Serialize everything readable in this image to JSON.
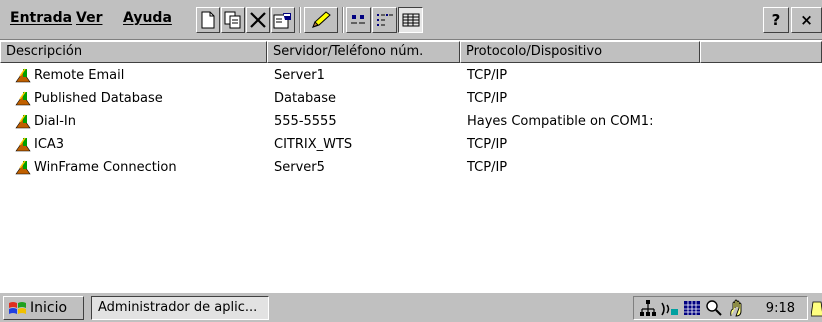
{
  "menus": [
    "Entrada",
    "Ver",
    "Ayuda"
  ],
  "toolbar": {
    "help_label": "?",
    "close_label": "×"
  },
  "columns": [
    "Descripción",
    "Servidor/Teléfono núm.",
    "Protocolo/Dispositivo"
  ],
  "entries": [
    {
      "description": "Remote Email",
      "server": "Server1",
      "protocol": "TCP/IP"
    },
    {
      "description": "Published Database",
      "server": "Database",
      "protocol": "TCP/IP"
    },
    {
      "description": "Dial-In",
      "server": "555-5555",
      "protocol": "Hayes Compatible on COM1:"
    },
    {
      "description": "ICA3",
      "server": "CITRIX_WTS",
      "protocol": "TCP/IP"
    },
    {
      "description": "WinFrame Connection",
      "server": "Server5",
      "protocol": "TCP/IP"
    }
  ],
  "taskbar": {
    "start_label": "Inicio",
    "task_label": "Administrador de aplic...",
    "clock": "9:18"
  },
  "icons": {
    "connection": "computer-connection-icon",
    "new": "new-document-icon",
    "copy": "copy-icon",
    "delete": "delete-x-icon",
    "properties": "properties-icon",
    "edit": "pencil-icon",
    "large_icons": "large-icons-view-icon",
    "list_view": "list-view-icon",
    "details_view": "details-view-icon"
  }
}
